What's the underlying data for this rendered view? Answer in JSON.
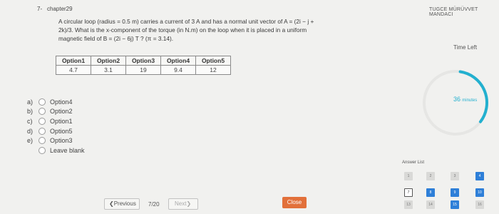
{
  "question": {
    "number": "7-",
    "chapter": "chapter29",
    "text_line1": "A circular loop (radius = 0.5 m) carries a current of 3 A and has a normal unit vector of A = (2i − j +",
    "text_line2": "2k)/3. What is the x-component of the torque (in N.m) on the loop when it is placed in a uniform",
    "text_line3": "magnetic field of  B = (2i − 6j) T ? (π = 3.14)."
  },
  "options_table": {
    "headers": [
      "Option1",
      "Option2",
      "Option3",
      "Option4",
      "Option5"
    ],
    "values": [
      "4.7",
      "3.1",
      "19",
      "9.4",
      "12"
    ]
  },
  "answers": [
    {
      "letter": "a)",
      "label": "Option4"
    },
    {
      "letter": "b)",
      "label": "Option2"
    },
    {
      "letter": "c)",
      "label": "Option1"
    },
    {
      "letter": "d)",
      "label": "Option5"
    },
    {
      "letter": "e)",
      "label": "Option3"
    }
  ],
  "leave_blank_label": "Leave blank",
  "navigation": {
    "previous_label": "❮Previous",
    "page_count": "7/20",
    "next_label": "Next❯",
    "close_label": "Close"
  },
  "sidebar": {
    "user_name": "TUGCE MÜRÜVVET MANDACI",
    "time_left_label": "Time Left",
    "timer_value": "36",
    "timer_unit": "minutes",
    "timer_fraction": 0.6,
    "answer_list_label": "Answer List",
    "answer_cells": [
      "1",
      "2",
      "3",
      "4",
      "7",
      "8",
      "9",
      "10",
      "13",
      "14",
      "15",
      "16"
    ]
  },
  "colors": {
    "accent": "#23b0cf",
    "answered": "#2e7fd8",
    "close": "#e2703a"
  }
}
